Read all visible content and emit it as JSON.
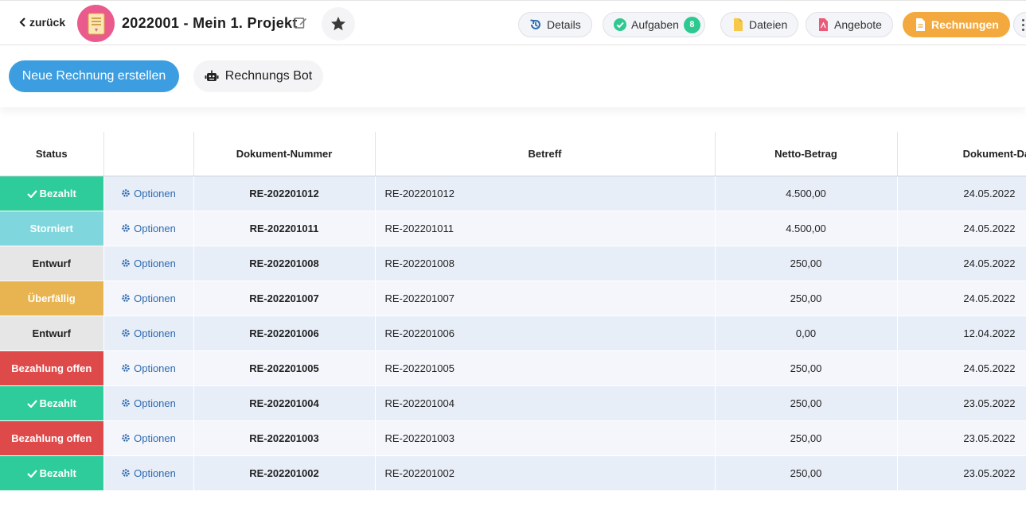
{
  "nav": {
    "back_label": "zurück"
  },
  "project": {
    "title": "2022001 - Mein 1. Projekt"
  },
  "tabs": [
    {
      "label": "Details",
      "icon": "history-icon"
    },
    {
      "label": "Aufgaben",
      "icon": "check-circle-icon",
      "badge": "8"
    },
    {
      "label": "Dateien",
      "icon": "file-icon"
    },
    {
      "label": "Angebote",
      "icon": "pdf-icon"
    },
    {
      "label": "Rechnungen",
      "icon": "invoice-icon",
      "active": true
    }
  ],
  "actions": {
    "new_invoice": "Neue Rechnung erstellen",
    "bot": "Rechnungs Bot"
  },
  "table": {
    "columns": [
      "Status",
      "",
      "Dokument-Nummer",
      "Betreff",
      "Netto-Betrag",
      "Dokument-Datum"
    ],
    "option_label": "Optionen",
    "rows": [
      {
        "status": "Bezahlt",
        "status_color": "#2ecc9a",
        "checked": true,
        "doc": "RE-202201012",
        "betreff": "RE-202201012",
        "netto": "4.500,00",
        "date": "24.05.2022"
      },
      {
        "status": "Storniert",
        "status_color": "#7fd6dc",
        "checked": false,
        "doc": "RE-202201011",
        "betreff": "RE-202201011",
        "netto": "4.500,00",
        "date": "24.05.2022"
      },
      {
        "status": "Entwurf",
        "status_color": "#e6e6e6",
        "checked": false,
        "dark": true,
        "doc": "RE-202201008",
        "betreff": "RE-202201008",
        "netto": "250,00",
        "date": "24.05.2022"
      },
      {
        "status": "Überfällig",
        "status_color": "#e8b451",
        "checked": false,
        "doc": "RE-202201007",
        "betreff": "RE-202201007",
        "netto": "250,00",
        "date": "24.05.2022"
      },
      {
        "status": "Entwurf",
        "status_color": "#e6e6e6",
        "checked": false,
        "dark": true,
        "doc": "RE-202201006",
        "betreff": "RE-202201006",
        "netto": "0,00",
        "date": "12.04.2022"
      },
      {
        "status": "Bezahlung offen",
        "status_color": "#de4a4a",
        "checked": false,
        "doc": "RE-202201005",
        "betreff": "RE-202201005",
        "netto": "250,00",
        "date": "24.05.2022"
      },
      {
        "status": "Bezahlt",
        "status_color": "#2ecc9a",
        "checked": true,
        "doc": "RE-202201004",
        "betreff": "RE-202201004",
        "netto": "250,00",
        "date": "23.05.2022"
      },
      {
        "status": "Bezahlung offen",
        "status_color": "#de4a4a",
        "checked": false,
        "doc": "RE-202201003",
        "betreff": "RE-202201003",
        "netto": "250,00",
        "date": "23.05.2022"
      },
      {
        "status": "Bezahlt",
        "status_color": "#2ecc9a",
        "checked": true,
        "doc": "RE-202201002",
        "betreff": "RE-202201002",
        "netto": "250,00",
        "date": "23.05.2022"
      }
    ]
  }
}
